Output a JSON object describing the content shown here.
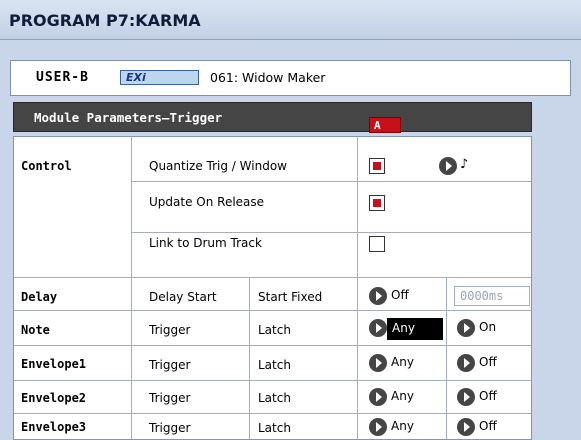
{
  "window": {
    "title": "PROGRAM P7:KARMA"
  },
  "program": {
    "bank": "USER-B",
    "type": "EXi",
    "name": "061: Widow Maker"
  },
  "panel": {
    "header": "Module Parameters–Trigger",
    "module_tag": "A"
  },
  "control": {
    "label": "Control",
    "items": [
      {
        "label": "Quantize Trig / Window",
        "checked": true
      },
      {
        "label": "Update On Release",
        "checked": true
      },
      {
        "label": "Link to Drum Track",
        "checked": false
      }
    ],
    "quantize_note_icon": "♪"
  },
  "rows": [
    {
      "label": "Delay",
      "col1": "Delay Start",
      "col2": "Start Fixed",
      "val1": "Off",
      "val2": "0000ms"
    },
    {
      "label": "Note",
      "col1": "Trigger",
      "col2": "Latch",
      "val1": "Any",
      "val2": "On"
    },
    {
      "label": "Envelope1",
      "col1": "Trigger",
      "col2": "Latch",
      "val1": "Any",
      "val2": "Off"
    },
    {
      "label": "Envelope2",
      "col1": "Trigger",
      "col2": "Latch",
      "val1": "Any",
      "val2": "Off"
    },
    {
      "label": "Envelope3",
      "col1": "Trigger",
      "col2": "Latch",
      "val1": "Any",
      "val2": "Off"
    }
  ],
  "colors": {
    "accent_red": "#c8101a",
    "header_dark": "#454545",
    "background_blue": "#c9d5e8"
  }
}
